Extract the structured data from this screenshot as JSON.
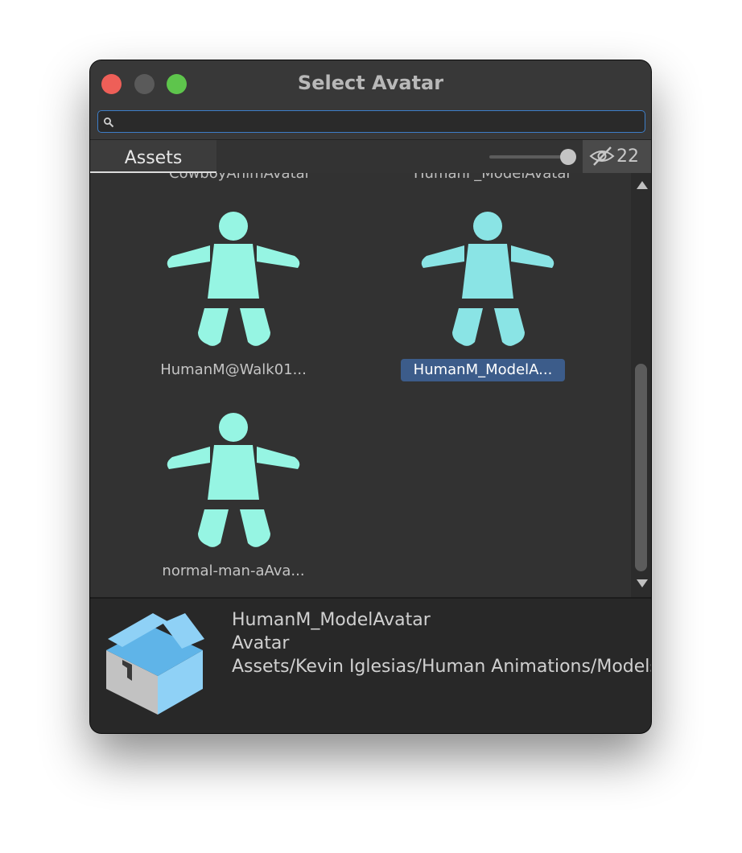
{
  "window": {
    "title": "Select Avatar"
  },
  "search": {
    "value": "",
    "placeholder": ""
  },
  "tabs": {
    "assets": "Assets"
  },
  "hidden_count": "22",
  "grid": {
    "top_labels_cut": [
      "CowboyAnimAvatar",
      "HumanF_ModelAvatar"
    ],
    "items": [
      {
        "label": "HumanM@Walk01...",
        "selected": false,
        "color": "#96f5e3"
      },
      {
        "label": "HumanM_ModelA...",
        "selected": true,
        "color": "#8ae4e5"
      },
      {
        "label": "normal-man-aAva...",
        "selected": false,
        "color": "#96f5e3"
      }
    ]
  },
  "preview": {
    "name": "HumanM_ModelAvatar",
    "type": "Avatar",
    "path": "Assets/Kevin Iglesias/Human Animations/Models/HumanM_ModelAvatar"
  },
  "colors": {
    "accent": "#3d7ec8",
    "selection": "#3c5c8a",
    "avatar": "#96f5e3"
  }
}
